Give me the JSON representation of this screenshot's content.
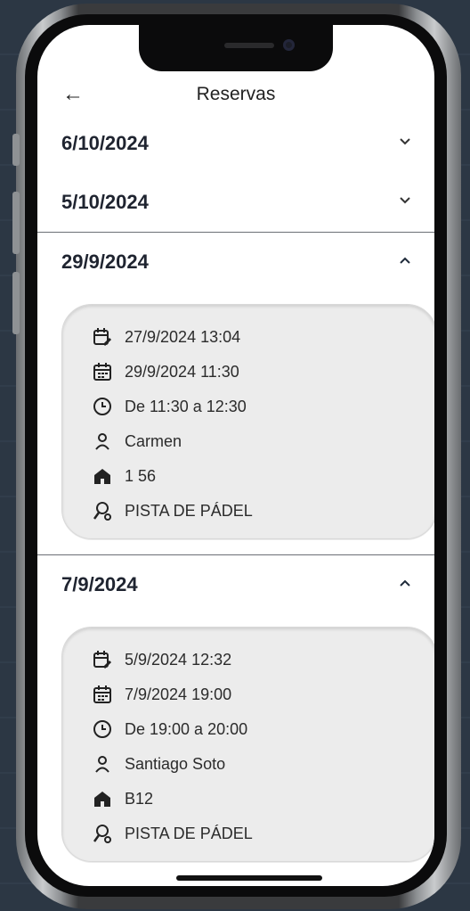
{
  "header": {
    "back_icon": "arrow-left-icon",
    "title": "Reservas"
  },
  "sections": [
    {
      "date": "6/10/2024",
      "expanded": false
    },
    {
      "date": "5/10/2024",
      "expanded": false
    },
    {
      "date": "29/9/2024",
      "expanded": true,
      "details": {
        "created": "27/9/2024 13:04",
        "reservation_date": "29/9/2024 11:30",
        "time_range": "De 11:30 a 12:30",
        "person": "Carmen",
        "home": "1 56",
        "facility": "PISTA DE PÁDEL"
      }
    },
    {
      "date": "7/9/2024",
      "expanded": true,
      "details": {
        "created": "5/9/2024 12:32",
        "reservation_date": "7/9/2024 19:00",
        "time_range": "De 19:00 a 20:00",
        "person": "Santiago Soto",
        "home": "B12",
        "facility": "PISTA DE PÁDEL"
      }
    }
  ],
  "colors": {
    "accent_dark": "#1f2430",
    "card_bg": "#ececec",
    "divider": "#6b6f75"
  }
}
